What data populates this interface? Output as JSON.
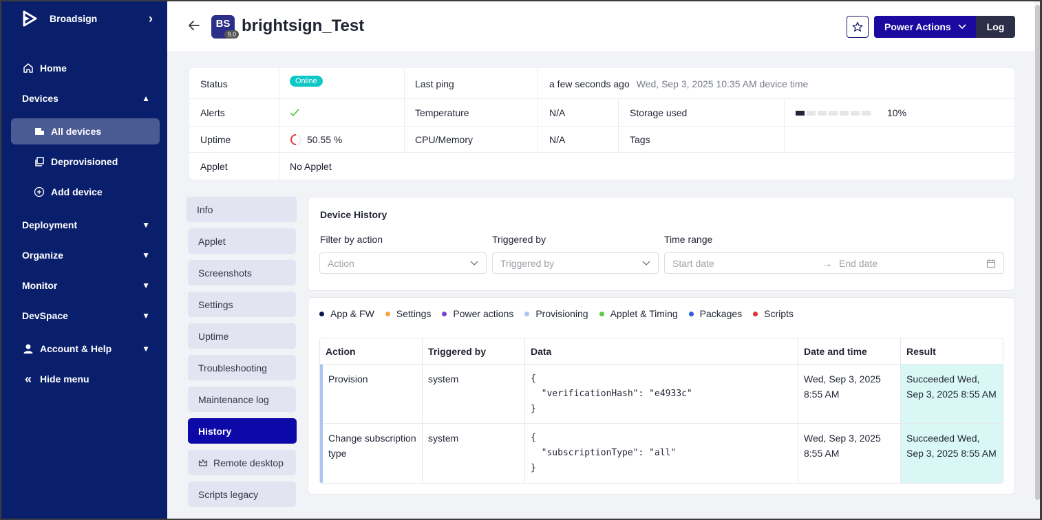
{
  "sidebar": {
    "brand": "Broadsign",
    "items": [
      {
        "label": "Home"
      },
      {
        "label": "Devices"
      },
      {
        "label": "All devices"
      },
      {
        "label": "Deprovisioned"
      },
      {
        "label": "Add device"
      },
      {
        "label": "Deployment"
      },
      {
        "label": "Organize"
      },
      {
        "label": "Monitor"
      },
      {
        "label": "DevSpace"
      },
      {
        "label": "Account & Help"
      },
      {
        "label": "Hide menu"
      }
    ]
  },
  "header": {
    "badge_initials": "BS",
    "badge_version": "9.0",
    "device_name": "brightsign_Test",
    "power_actions": "Power Actions",
    "log": "Log"
  },
  "status": {
    "status_label": "Status",
    "status_value": "Online",
    "last_ping_label": "Last ping",
    "last_ping_value": "a few seconds ago",
    "last_ping_time": "Wed, Sep 3, 2025 10:35 AM device time",
    "alerts_label": "Alerts",
    "temperature_label": "Temperature",
    "temperature_value": "N/A",
    "storage_label": "Storage used",
    "storage_value": "10%",
    "storage_fraction": 0.1,
    "uptime_label": "Uptime",
    "uptime_value": "50.55 %",
    "cpu_label": "CPU/Memory",
    "cpu_value": "N/A",
    "tags_label": "Tags",
    "applet_label": "Applet",
    "applet_value": "No Applet"
  },
  "tabs": [
    {
      "label": "Info"
    },
    {
      "label": "Applet"
    },
    {
      "label": "Screenshots"
    },
    {
      "label": "Settings"
    },
    {
      "label": "Uptime"
    },
    {
      "label": "Troubleshooting"
    },
    {
      "label": "Maintenance log"
    },
    {
      "label": "History"
    },
    {
      "label": "Remote desktop"
    },
    {
      "label": "Scripts legacy"
    }
  ],
  "history": {
    "title": "Device History",
    "filter_action_label": "Filter by action",
    "filter_action_placeholder": "Action",
    "triggered_label": "Triggered by",
    "triggered_placeholder": "Triggered by",
    "time_range_label": "Time range",
    "start_placeholder": "Start date",
    "end_placeholder": "End date"
  },
  "legend": [
    {
      "label": "App & FW",
      "color": "#0c1450"
    },
    {
      "label": "Settings",
      "color": "#f5a442"
    },
    {
      "label": "Power actions",
      "color": "#7a3fc7"
    },
    {
      "label": "Provisioning",
      "color": "#a9c8f5"
    },
    {
      "label": "Applet & Timing",
      "color": "#5ccb3f"
    },
    {
      "label": "Packages",
      "color": "#2a5fdc"
    },
    {
      "label": "Scripts",
      "color": "#e0303a"
    }
  ],
  "table": {
    "headers": [
      "Action",
      "Triggered by",
      "Data",
      "Date and time",
      "Result"
    ],
    "rows": [
      {
        "action": "Provision",
        "triggered": "system",
        "data": "{\n  \"verificationHash\": \"e4933c\"\n}",
        "date": "Wed, Sep 3, 2025 8:55 AM",
        "result": "Succeeded Wed, Sep 3, 2025 8:55 AM"
      },
      {
        "action": "Change subscription type",
        "triggered": "system",
        "data": "{\n  \"subscriptionType\": \"all\"\n}",
        "date": "Wed, Sep 3, 2025 8:55 AM",
        "result": "Succeeded Wed, Sep 3, 2025 8:55 AM"
      }
    ]
  }
}
